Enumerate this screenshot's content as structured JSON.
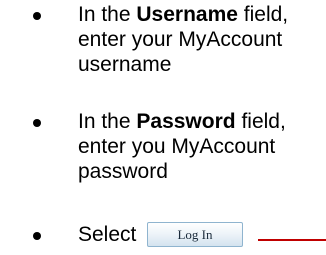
{
  "instructions": [
    {
      "prefix": "In the ",
      "field_name": "Username",
      "suffix_line1": " field,",
      "line2": "enter your MyAccount",
      "line3": "username"
    },
    {
      "prefix": "In the ",
      "field_name": "Password",
      "suffix_line1": " field,",
      "line2": "enter you MyAccount",
      "line3": "password"
    },
    {
      "select_label": "Select",
      "button_label": "Log In"
    }
  ],
  "colors": {
    "button_border": "#8fb4cf",
    "pointer_line": "#c00000"
  },
  "icons": [
    "bullet-icon",
    "pointer-line"
  ]
}
